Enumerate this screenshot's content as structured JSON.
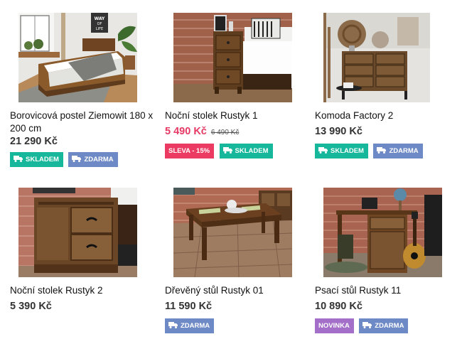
{
  "products": [
    {
      "name": "Borovicová postel Ziemowit 180 x 200 cm",
      "price": "21 290 Kč",
      "badges": [
        {
          "label": "SKLADEM",
          "color": "#16b79a",
          "icon": "truck-icon"
        },
        {
          "label": "ZDARMA",
          "color": "#6d8ac6",
          "icon": "truck-icon"
        }
      ]
    },
    {
      "name": "Noční stolek Rustyk 1",
      "price": "5 490 Kč",
      "old_price": "6 490 Kč",
      "badges": [
        {
          "label": "SLEVA - 15%",
          "color": "#ec3b62"
        },
        {
          "label": "SKLADEM",
          "color": "#16b79a",
          "icon": "truck-icon"
        }
      ]
    },
    {
      "name": "Komoda Factory 2",
      "price": "13 990 Kč",
      "badges": [
        {
          "label": "SKLADEM",
          "color": "#16b79a",
          "icon": "truck-icon"
        },
        {
          "label": "ZDARMA",
          "color": "#6d8ac6",
          "icon": "truck-icon"
        }
      ]
    },
    {
      "name": "Noční stolek Rustyk 2",
      "price": "5 390 Kč",
      "badges": []
    },
    {
      "name": "Dřevěný stůl Rustyk 01",
      "price": "11 590 Kč",
      "badges": [
        {
          "label": "ZDARMA",
          "color": "#6d8ac6",
          "icon": "truck-icon"
        }
      ]
    },
    {
      "name": "Psací stůl Rustyk 11",
      "price": "10 890 Kč",
      "badges": [
        {
          "label": "NOVINKA",
          "color": "#a36fc9"
        },
        {
          "label": "ZDARMA",
          "color": "#6d8ac6",
          "icon": "truck-icon"
        }
      ]
    }
  ],
  "image_signs": {
    "way_of_life": "WAY\nOF\nLIFE"
  }
}
